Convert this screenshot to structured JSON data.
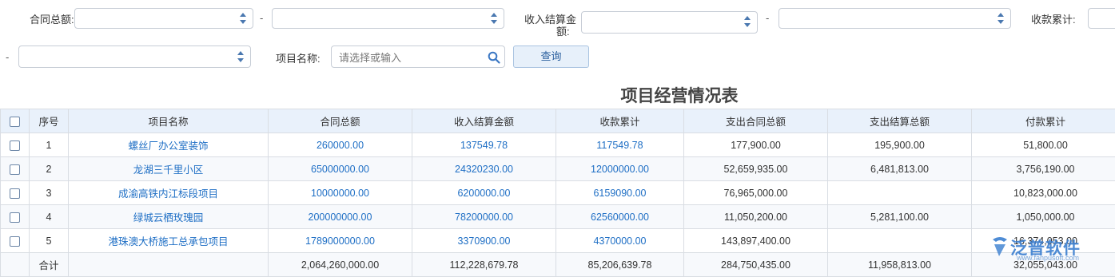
{
  "filters": {
    "contract_total_label": "合同总额:",
    "range_dash": "-",
    "income_settle_label_line1": "收入结算金",
    "income_settle_label_line2": "额:",
    "received_total_label": "收款累计:",
    "project_name_label": "项目名称:",
    "project_name_placeholder": "请选择或输入",
    "query_button": "查询"
  },
  "report": {
    "title": "项目经营情况表",
    "columns": [
      "序号",
      "项目名称",
      "合同总额",
      "收入结算金额",
      "收款累计",
      "支出合同总额",
      "支出结算总额",
      "付款累计"
    ],
    "rows": [
      {
        "no": "1",
        "name": "螺丝厂办公室装饰",
        "contract": "260000.00",
        "income": "137549.78",
        "received": "117549.78",
        "out_contract": "177,900.00",
        "out_settle": "195,900.00",
        "paid": "51,800.00"
      },
      {
        "no": "2",
        "name": "龙湖三千里小区",
        "contract": "65000000.00",
        "income": "24320230.00",
        "received": "12000000.00",
        "out_contract": "52,659,935.00",
        "out_settle": "6,481,813.00",
        "paid": "3,756,190.00"
      },
      {
        "no": "3",
        "name": "成渝高铁内江标段项目",
        "contract": "10000000.00",
        "income": "6200000.00",
        "received": "6159090.00",
        "out_contract": "76,965,000.00",
        "out_settle": "",
        "paid": "10,823,000.00"
      },
      {
        "no": "4",
        "name": "绿城云栖玫瑰园",
        "contract": "200000000.00",
        "income": "78200000.00",
        "received": "62560000.00",
        "out_contract": "11,050,200.00",
        "out_settle": "5,281,100.00",
        "paid": "1,050,000.00"
      },
      {
        "no": "5",
        "name": "港珠澳大桥施工总承包项目",
        "contract": "1789000000.00",
        "income": "3370900.00",
        "received": "4370000.00",
        "out_contract": "143,897,400.00",
        "out_settle": "",
        "paid": "16,374,053.00"
      }
    ],
    "total": {
      "label": "合计",
      "contract": "2,064,260,000.00",
      "income": "112,228,679.78",
      "received": "85,206,639.78",
      "out_contract": "284,750,435.00",
      "out_settle": "11,958,813.00",
      "paid": "32,055,043.00"
    }
  },
  "brand": {
    "name": "泛普软件",
    "url": "www.fanpusoft.com",
    "color": "#3b7fd0"
  }
}
